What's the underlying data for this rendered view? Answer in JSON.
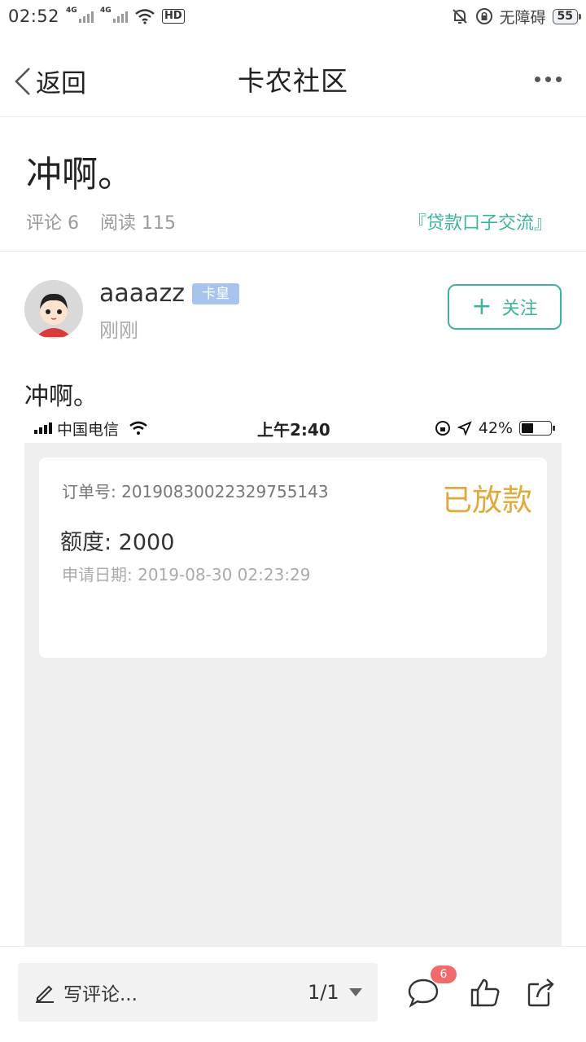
{
  "status_bar": {
    "time": "02:52",
    "network_1": "4G",
    "network_2": "4G",
    "hd_label": "HD",
    "accessibility": "无障碍",
    "battery": "55"
  },
  "nav": {
    "back_label": "返回",
    "title": "卡农社区"
  },
  "post": {
    "title": "冲啊。",
    "comments_label": "评论 6",
    "reads_label": "阅读 115",
    "category": "『贷款口子交流』",
    "body_text": "冲啊。"
  },
  "author": {
    "name": "aaaazz",
    "badge": "卡皇",
    "time": "刚刚",
    "follow_label": "关注"
  },
  "embedded_screenshot": {
    "carrier": "中国电信",
    "time": "上午2:40",
    "battery": "42%",
    "order_no": "订单号: 20190830022329755143",
    "status": "已放款",
    "amount": "额度: 2000",
    "date": "申请日期: 2019-08-30 02:23:29"
  },
  "bottom_bar": {
    "comment_placeholder": "写评论...",
    "page_indicator": "1/1",
    "comment_count": "6"
  }
}
